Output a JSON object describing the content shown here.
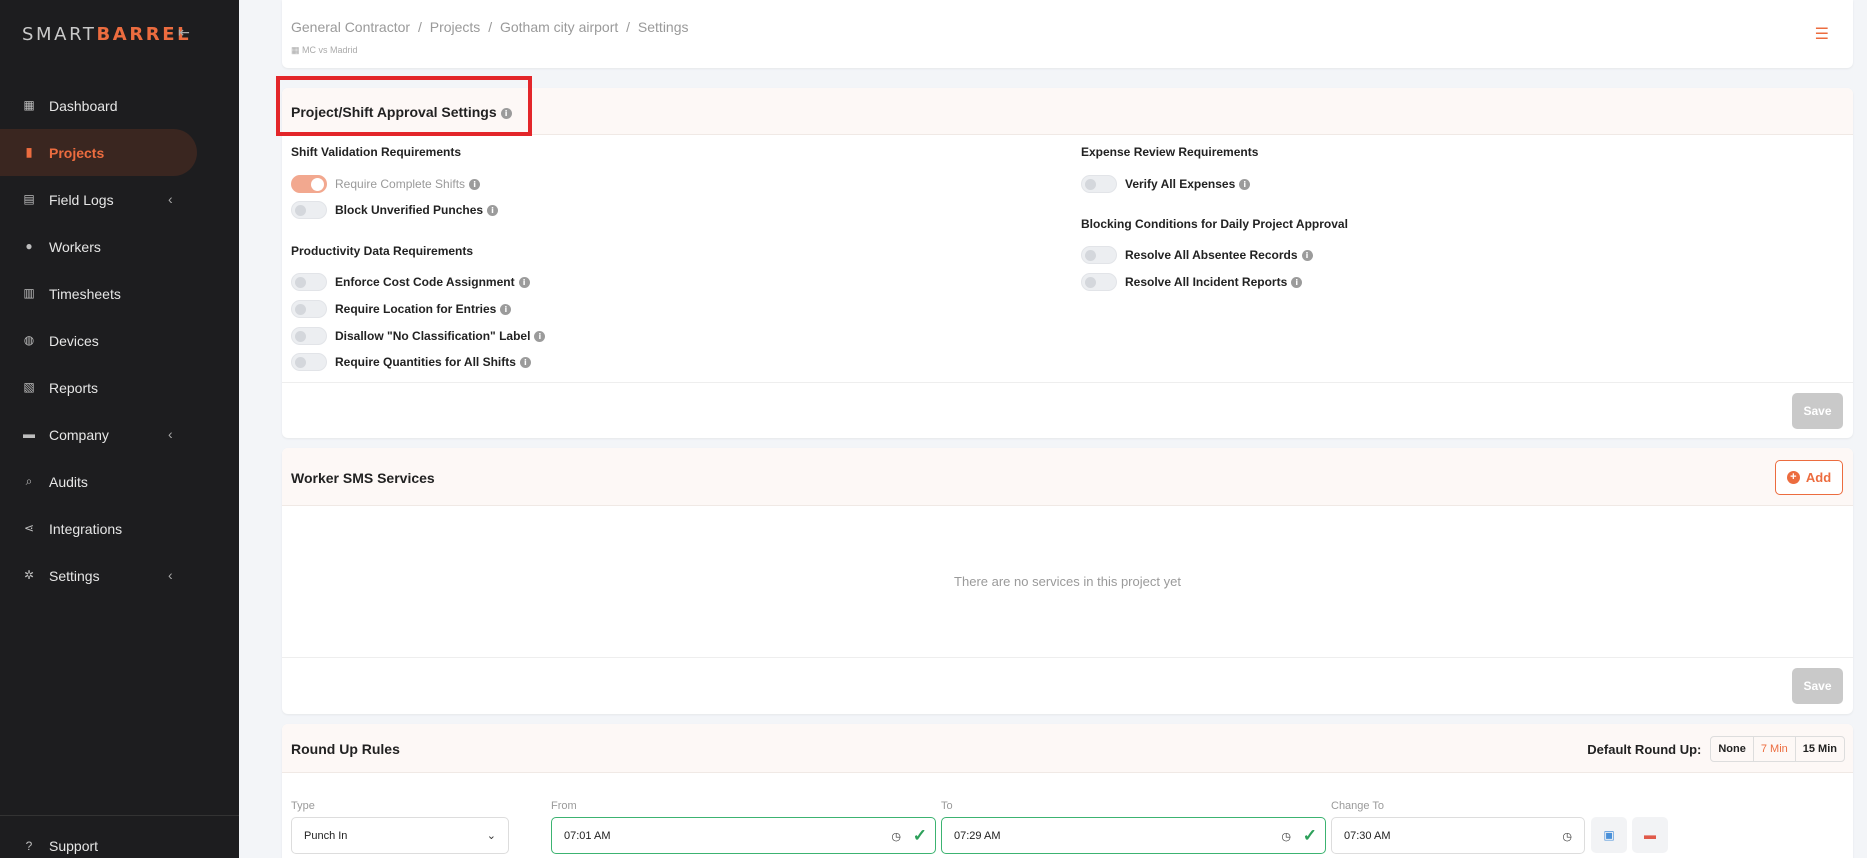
{
  "logo": {
    "part1": "SMART",
    "part2": "BARREL"
  },
  "sidebar": {
    "items": [
      {
        "label": "Dashboard"
      },
      {
        "label": "Projects"
      },
      {
        "label": "Field Logs"
      },
      {
        "label": "Workers"
      },
      {
        "label": "Timesheets"
      },
      {
        "label": "Devices"
      },
      {
        "label": "Reports"
      },
      {
        "label": "Company"
      },
      {
        "label": "Audits"
      },
      {
        "label": "Integrations"
      },
      {
        "label": "Settings"
      }
    ],
    "support": "Support"
  },
  "header": {
    "crumbs": [
      "General Contractor",
      "Projects",
      "Gotham city airport",
      "Settings"
    ],
    "separator": "/",
    "sub": "MC vs Madrid"
  },
  "approval": {
    "title": "Project/Shift Approval Settings",
    "shift_validation": {
      "heading": "Shift Validation Requirements",
      "items": [
        {
          "label": "Require Complete Shifts",
          "on": true
        },
        {
          "label": "Block Unverified Punches",
          "on": false
        }
      ]
    },
    "productivity": {
      "heading": "Productivity Data Requirements",
      "items": [
        {
          "label": "Enforce Cost Code Assignment",
          "on": false
        },
        {
          "label": "Require Location for Entries",
          "on": false
        },
        {
          "label": "Disallow \"No Classification\" Label",
          "on": false
        },
        {
          "label": "Require Quantities for All Shifts",
          "on": false
        }
      ]
    },
    "expense": {
      "heading": "Expense Review Requirements",
      "items": [
        {
          "label": "Verify All Expenses",
          "on": false
        }
      ]
    },
    "blocking": {
      "heading": "Blocking Conditions for Daily Project Approval",
      "items": [
        {
          "label": "Resolve All Absentee Records",
          "on": false
        },
        {
          "label": "Resolve All Incident Reports",
          "on": false
        }
      ]
    },
    "save": "Save"
  },
  "sms": {
    "title": "Worker SMS Services",
    "add": "Add",
    "empty": "There are no services in this project yet",
    "save": "Save"
  },
  "round": {
    "title": "Round Up Rules",
    "default_label": "Default Round Up:",
    "options": [
      "None",
      "7 Min",
      "15 Min"
    ],
    "selected": "7 Min",
    "labels": {
      "type": "Type",
      "from": "From",
      "to": "To",
      "change": "Change To"
    },
    "row": {
      "type": "Punch In",
      "from": "07:01  AM",
      "to": "07:29  AM",
      "change": "07:30  AM"
    }
  },
  "colors": {
    "accent": "#ec6c3f",
    "sidebar_bg": "#1d1d1f",
    "highlight": "#e3262a",
    "valid": "#3cb371"
  }
}
